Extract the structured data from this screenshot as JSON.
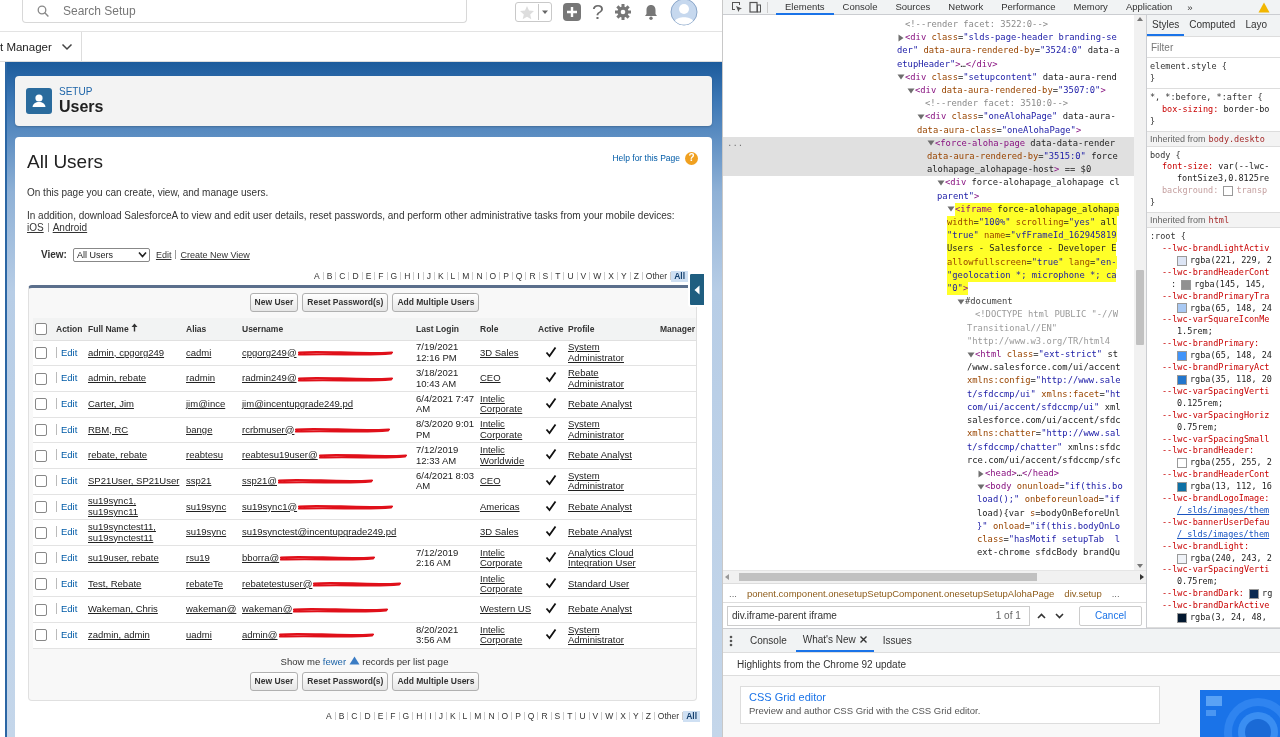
{
  "search": {
    "placeholder": "Search Setup"
  },
  "topbar": {
    "help": "?"
  },
  "nav": {
    "label": "t Manager"
  },
  "header": {
    "eyebrow": "SETUP",
    "title": "Users"
  },
  "page": {
    "title": "All Users",
    "help_link": "Help for this Page",
    "help_icon": "?",
    "intro": "On this page you can create, view, and manage users.",
    "mobile_text": "In addition, download SalesforceA to view and edit user details, reset passwords, and perform other administrative tasks from your mobile devices:",
    "mobile_links": [
      "iOS",
      "Android"
    ]
  },
  "view": {
    "label": "View:",
    "value": "All Users",
    "links": [
      "Edit",
      "Create New View"
    ]
  },
  "alphabet_top": [
    {
      "letter": "A",
      "selected": false
    },
    {
      "letter": "B",
      "selected": false
    },
    {
      "letter": "C",
      "selected": false
    },
    {
      "letter": "D",
      "selected": false
    },
    {
      "letter": "E",
      "selected": false
    },
    {
      "letter": "F",
      "selected": false
    },
    {
      "letter": "G",
      "selected": false
    },
    {
      "letter": "H",
      "selected": false
    },
    {
      "letter": "I",
      "selected": false
    },
    {
      "letter": "J",
      "selected": false
    },
    {
      "letter": "K",
      "selected": false
    },
    {
      "letter": "L",
      "selected": false
    },
    {
      "letter": "M",
      "selected": false
    },
    {
      "letter": "N",
      "selected": false
    },
    {
      "letter": "O",
      "selected": false
    },
    {
      "letter": "P",
      "selected": false
    },
    {
      "letter": "Q",
      "selected": false
    },
    {
      "letter": "R",
      "selected": false
    },
    {
      "letter": "S",
      "selected": false
    },
    {
      "letter": "T",
      "selected": false
    },
    {
      "letter": "U",
      "selected": false
    },
    {
      "letter": "V",
      "selected": false
    },
    {
      "letter": "W",
      "selected": false
    },
    {
      "letter": "X",
      "selected": false
    },
    {
      "letter": "Y",
      "selected": false
    },
    {
      "letter": "Z",
      "selected": false
    },
    {
      "letter": "Other",
      "selected": false
    },
    {
      "letter": "All",
      "selected": true
    }
  ],
  "buttons_top": [
    "New User",
    "Reset Password(s)",
    "Add Multiple Users"
  ],
  "table": {
    "select_all": {
      "checked": false
    },
    "columns": [
      {
        "label": "Action"
      },
      {
        "label": "Full Name",
        "sorted_ascending": true
      },
      {
        "label": "Alias"
      },
      {
        "label": "Username"
      },
      {
        "label": "Last Login"
      },
      {
        "label": "Role"
      },
      {
        "label": "Active"
      },
      {
        "label": "Profile"
      },
      {
        "label": "Manager"
      }
    ],
    "rows": [
      {
        "checked": false,
        "action": "Edit",
        "full_name": "admin, cpgorg249",
        "alias": "cadmi",
        "username": "cpgorg249@",
        "redacted": true,
        "last_login": "7/19/2021 12:16 PM",
        "role": "3D Sales",
        "active": true,
        "profile": "System Administrator"
      },
      {
        "checked": false,
        "action": "Edit",
        "full_name": "admin, rebate",
        "alias": "radmin",
        "username": "radmin249@",
        "redacted": true,
        "last_login": "3/18/2021 10:43 AM",
        "role": "CEO",
        "active": true,
        "profile": "Rebate Administrator"
      },
      {
        "checked": false,
        "action": "Edit",
        "full_name": "Carter, Jim",
        "alias": "jim@ince",
        "username": "jim@incentupgrade249.pd",
        "last_login": "6/4/2021 7:47 AM",
        "role": "Intelic Corporate",
        "active": true,
        "profile": "Rebate Analyst"
      },
      {
        "checked": false,
        "action": "Edit",
        "full_name": "RBM, RC",
        "alias": "bange",
        "username": "rcrbmuser@",
        "redacted": true,
        "last_login": "8/3/2020 9:01 PM",
        "role": "Intelic Corporate",
        "active": true,
        "profile": "System Administrator"
      },
      {
        "checked": false,
        "action": "Edit",
        "full_name": "rebate, rebate",
        "alias": "reabtesu",
        "username": "reabtesu19user@",
        "redacted": true,
        "last_login": "7/12/2019 12:33 AM",
        "role": "Intelic Worldwide",
        "active": true,
        "profile": "Rebate Analyst"
      },
      {
        "checked": false,
        "action": "Edit",
        "full_name": "SP21User, SP21User",
        "alias": "ssp21",
        "username": "ssp21@",
        "redacted": true,
        "last_login": "6/4/2021 8:03 AM",
        "role": "CEO",
        "active": true,
        "profile": "System Administrator"
      },
      {
        "checked": false,
        "action": "Edit",
        "full_name": "su19sync1, su19sync11",
        "alias": "su19sync",
        "username": "su19sync1@",
        "redacted": true,
        "role": "Americas",
        "active": true,
        "profile": "Rebate Analyst"
      },
      {
        "checked": false,
        "action": "Edit",
        "full_name": "su19synctest11, su19synctest11",
        "alias": "su19sync",
        "username": "su19synctest@incentupgrade249.pd",
        "role": "3D Sales",
        "active": true,
        "profile": "Rebate Analyst"
      },
      {
        "checked": false,
        "action": "Edit",
        "full_name": "su19user, rebate",
        "alias": "rsu19",
        "username": "bborra@",
        "redacted": true,
        "last_login": "7/12/2019 2:16 AM",
        "role": "Intelic Corporate",
        "active": true,
        "profile": "Analytics Cloud Integration User"
      },
      {
        "checked": false,
        "action": "Edit",
        "full_name": "Test, Rebate",
        "alias": "rebateTe",
        "username": "rebatetestuser@",
        "redacted": true,
        "role": "Intelic Corporate",
        "active": true,
        "profile": "Standard User"
      },
      {
        "checked": false,
        "action": "Edit",
        "full_name": "Wakeman, Chris",
        "alias": "wakeman@",
        "username": "wakeman@",
        "redacted": true,
        "role": "Western US",
        "active": true,
        "profile": "Rebate Analyst"
      },
      {
        "checked": false,
        "action": "Edit",
        "full_name": "zadmin, admin",
        "alias": "uadmi",
        "username": "admin@",
        "redacted": true,
        "last_login": "8/20/2021 3:56 AM",
        "role": "Intelic Corporate",
        "active": true,
        "profile": "System Administrator"
      }
    ]
  },
  "pager": {
    "before": "Show me",
    "link": "fewer",
    "after": "records per list page"
  },
  "buttons_bottom": [
    "New User",
    "Reset Password(s)",
    "Add Multiple Users"
  ],
  "alphabet_bottom": [
    {
      "letter": "A",
      "selected": false
    },
    {
      "letter": "B",
      "selected": false
    },
    {
      "letter": "C",
      "selected": false
    },
    {
      "letter": "D",
      "selected": false
    },
    {
      "letter": "E",
      "selected": false
    },
    {
      "letter": "F",
      "selected": false
    },
    {
      "letter": "G",
      "selected": false
    },
    {
      "letter": "H",
      "selected": false
    },
    {
      "letter": "I",
      "selected": false
    },
    {
      "letter": "J",
      "selected": false
    },
    {
      "letter": "K",
      "selected": false
    },
    {
      "letter": "L",
      "selected": false
    },
    {
      "letter": "M",
      "selected": false
    },
    {
      "letter": "N",
      "selected": false
    },
    {
      "letter": "O",
      "selected": false
    },
    {
      "letter": "P",
      "selected": false
    },
    {
      "letter": "Q",
      "selected": false
    },
    {
      "letter": "R",
      "selected": false
    },
    {
      "letter": "S",
      "selected": false
    },
    {
      "letter": "T",
      "selected": false
    },
    {
      "letter": "U",
      "selected": false
    },
    {
      "letter": "V",
      "selected": false
    },
    {
      "letter": "W",
      "selected": false
    },
    {
      "letter": "X",
      "selected": false
    },
    {
      "letter": "Y",
      "selected": false
    },
    {
      "letter": "Z",
      "selected": false
    },
    {
      "letter": "Other",
      "selected": false
    },
    {
      "letter": "All",
      "selected": true
    }
  ],
  "devtools": {
    "tabs": [
      {
        "label": "Elements",
        "selected": true
      },
      {
        "label": "Console",
        "selected": false
      },
      {
        "label": "Sources",
        "selected": false
      },
      {
        "label": "Network",
        "selected": false
      },
      {
        "label": "Performance",
        "selected": false
      },
      {
        "label": "Memory",
        "selected": false
      },
      {
        "label": "Application",
        "selected": false
      }
    ],
    "overflow": "»",
    "dom": [
      {
        "kind": "comment",
        "lines": [
          "<!--render facet: 3522:0-->"
        ],
        "selected": false,
        "match": false
      },
      {
        "kind": "element",
        "lines": [
          "<div class=\"slds-page-header branding-se",
          "der\" data-aura-rendered-by=\"3524:0\" data-a",
          "etupHeader\">…</div>"
        ],
        "expanded": false,
        "selected": false,
        "match": false
      },
      {
        "kind": "element",
        "lines": [
          "<div class=\"setupcontent\" data-aura-rend"
        ],
        "expanded": true,
        "selected": false,
        "match": false,
        "children": [
          {
            "kind": "element",
            "lines": [
              "<div data-aura-rendered-by=\"3507:0\">"
            ],
            "expanded": true,
            "selected": false,
            "match": false,
            "children": [
              {
                "kind": "comment",
                "lines": [
                  "<!--render facet: 3510:0-->"
                ],
                "selected": false,
                "match": false
              },
              {
                "kind": "element",
                "lines": [
                  "<div class=\"oneAlohaPage\" data-aura-",
                  "data-aura-class=\"oneAlohaPage\">"
                ],
                "expanded": true,
                "selected": false,
                "match": false,
                "children": [
                  {
                    "kind": "element",
                    "lines": [
                      "<force-aloha-page data-data-render",
                      "data-aura-rendered-by=\"3515:0\" force",
                      "alohapage_alohapage-host> == $0"
                    ],
                    "expanded": true,
                    "selected": true,
                    "match": false,
                    "gutter": "...",
                    "children": [
                      {
                        "kind": "element",
                        "lines": [
                          "<div force-alohapage_alohapage cl",
                          "parent\">"
                        ],
                        "expanded": true,
                        "selected": false,
                        "match": false,
                        "children": [
                          {
                            "kind": "element",
                            "lines": [
                              "<iframe force-alohapage_alohapa",
                              "width=\"100%\" scrolling=\"yes\" all",
                              "\"true\" name=\"vfFrameId_162945819",
                              "Users - Salesforce - Developer E",
                              "allowfullscreen=\"true\" lang=\"en-",
                              "\"geolocation *; microphone *; ca",
                              "\"0\">"
                            ],
                            "expanded": true,
                            "selected": false,
                            "match": true,
                            "children": [
                              {
                                "kind": "document",
                                "lines": [
                                  "#document"
                                ],
                                "expanded": true,
                                "selected": false,
                                "match": false,
                                "children": [
                                  {
                                    "kind": "doctype",
                                    "lines": [
                                      "<!DOCTYPE html PUBLIC \"-//W",
                                      "Transitional//EN\"",
                                      "\"http://www.w3.org/TR/html4"
                                    ],
                                    "selected": false,
                                    "match": false
                                  },
                                  {
                                    "kind": "element",
                                    "lines": [
                                      "<html class=\"ext-strict\" st",
                                      "/www.salesforce.com/ui/accent",
                                      "xmlns:config=\"http://www.sale",
                                      "t/sfdccmp/ui\" xmlns:facet=\"ht",
                                      "com/ui/accent/sfdccmp/ui\" xml",
                                      "salesforce.com/ui/accent/sfdc",
                                      "xmlns:chatter=\"http://www.sal",
                                      "t/sfdccmp/chatter\" xmlns:sfdc",
                                      "rce.com/ui/accent/sfdccmp/sfc"
                                    ],
                                    "expanded": true,
                                    "selected": false,
                                    "match": false,
                                    "children": [
                                      {
                                        "kind": "element",
                                        "lines": [
                                          "<head>…</head>"
                                        ],
                                        "expanded": false,
                                        "selected": false,
                                        "match": false
                                      },
                                      {
                                        "kind": "element",
                                        "lines": [
                                          "<body onunload=\"if(this.bo",
                                          "load();\" onbeforeunload=\"if",
                                          "load){var s=bodyOnBeforeUnl",
                                          "}\" onload=\"if(this.bodyOnLo",
                                          "class=\"hasMotif setupTab  l",
                                          "ext-chrome sfdcBody brandQu"
                                        ],
                                        "expanded": true,
                                        "selected": false,
                                        "match": false
                                      }
                                    ]
                                  }
                                ]
                              }
                            ]
                          }
                        ]
                      }
                    ]
                  }
                ]
              }
            ]
          }
        ]
      }
    ],
    "breadcrumb": [
      {
        "kind": "ellipsis",
        "text": "..."
      },
      {
        "kind": "crumb",
        "text": "ponent.component.onesetupSetupComponent.onesetupSetupAlohaPage"
      },
      {
        "kind": "crumb",
        "text": "div.setup"
      },
      {
        "kind": "ellipsis",
        "text": "..."
      }
    ],
    "find": {
      "value": "div.iframe-parent iframe",
      "count": "1 of 1",
      "cancel": "Cancel"
    },
    "styles": {
      "tabs": [
        {
          "label": "Styles",
          "selected": true
        },
        {
          "label": "Computed",
          "selected": false
        },
        {
          "label": "Layo",
          "selected": false
        }
      ],
      "filter": {
        "placeholder": "Filter"
      },
      "sections": [
        {
          "kind": "rule",
          "lines": [
            {
              "kind": "selector",
              "text": "element.style {"
            },
            {
              "kind": "brace",
              "text": "}"
            }
          ]
        },
        {
          "kind": "rule",
          "lines": [
            {
              "kind": "selector",
              "text": "*, *:before, *:after {"
            },
            {
              "kind": "decl",
              "name": "box-sizing:",
              "value": "border-bo",
              "inactive": false
            },
            {
              "kind": "brace",
              "text": "}"
            }
          ]
        },
        {
          "kind": "inherited",
          "label": "Inherited from",
          "source": "body.deskto"
        },
        {
          "kind": "rule",
          "lines": [
            {
              "kind": "selector",
              "text": "body {"
            },
            {
              "kind": "decl",
              "name": "font-size:",
              "value": "var(--lwc-",
              "inactive": false
            },
            {
              "kind": "value",
              "text": "fontSize3,0.8125re"
            },
            {
              "kind": "decl",
              "name": "background:",
              "value": "transp",
              "inactive": true,
              "color": "#ffffff"
            },
            {
              "kind": "brace",
              "text": "}"
            }
          ]
        },
        {
          "kind": "inherited",
          "label": "Inherited from",
          "source": "html"
        },
        {
          "kind": "rule",
          "lines": [
            {
              "kind": "selector",
              "text": ":root {"
            },
            {
              "kind": "decl",
              "name": "--lwc-brandLightActiv",
              "inactive": false
            },
            {
              "kind": "value",
              "color": "#dde5f5",
              "text": "rgba(221, 229, 2"
            },
            {
              "kind": "decl",
              "name": "--lwc-brandHeaderCont",
              "inactive": false
            },
            {
              "kind": "value",
              "lead": ":",
              "color": "#919191",
              "text": "rgba(145, 145,"
            },
            {
              "kind": "decl",
              "name": "--lwc-brandPrimaryTra",
              "inactive": false
            },
            {
              "kind": "value",
              "color": "#a9c9f3",
              "text": "rgba(65, 148, 24"
            },
            {
              "kind": "decl",
              "name": "--lwc-varSquareIconMe",
              "inactive": false
            },
            {
              "kind": "value",
              "text": "1.5rem;"
            },
            {
              "kind": "decl",
              "name": "--lwc-brandPrimary:",
              "inactive": false
            },
            {
              "kind": "value",
              "color": "#4194f9",
              "text": "rgba(65, 148, 24"
            },
            {
              "kind": "decl",
              "name": "--lwc-brandPrimaryAct",
              "inactive": false
            },
            {
              "kind": "value",
              "color": "#2376cc",
              "text": "rgba(35, 118, 20"
            },
            {
              "kind": "decl",
              "name": "--lwc-varSpacingVerti",
              "inactive": false
            },
            {
              "kind": "value",
              "text": "0.125rem;"
            },
            {
              "kind": "decl",
              "name": "--lwc-varSpacingHoriz",
              "inactive": false
            },
            {
              "kind": "value",
              "text": "0.75rem;"
            },
            {
              "kind": "decl",
              "name": "--lwc-varSpacingSmall",
              "inactive": false
            },
            {
              "kind": "decl",
              "name": "--lwc-brandHeader:",
              "inactive": false
            },
            {
              "kind": "value",
              "color": "#ffffff",
              "text": "rgba(255, 255, 2"
            },
            {
              "kind": "decl",
              "name": "--lwc-brandHeaderCont",
              "inactive": false
            },
            {
              "kind": "value",
              "color": "#0d70a5",
              "text": "rgba(13, 112, 16"
            },
            {
              "kind": "decl",
              "name": "--lwc-brandLogoImage:",
              "inactive": false
            },
            {
              "kind": "link",
              "text": "/_slds/images/them"
            },
            {
              "kind": "decl",
              "name": "--lwc-bannerUserDefau",
              "inactive": false
            },
            {
              "kind": "link",
              "text": "/_slds/images/them"
            },
            {
              "kind": "decl",
              "name": "--lwc-brandLight:",
              "inactive": false
            },
            {
              "kind": "value",
              "color": "#f0f3f8",
              "text": "rgba(240, 243, 2"
            },
            {
              "kind": "decl",
              "name": "--lwc-varSpacingVerti",
              "inactive": false
            },
            {
              "kind": "value",
              "text": "0.75rem;"
            },
            {
              "kind": "decl",
              "name": "--lwc-brandDark:",
              "color": "#0b2a52",
              "value": "rg",
              "inactive": false
            },
            {
              "kind": "decl",
              "name": "--lwc-brandDarkActive",
              "inactive": false
            },
            {
              "kind": "value",
              "color": "#031830",
              "text": "rgba(3, 24, 48,"
            }
          ]
        }
      ]
    },
    "drawer": {
      "tabs": [
        {
          "label": "Console",
          "selected": false,
          "closable": false
        },
        {
          "label": "What's New",
          "selected": true,
          "closable": true
        },
        {
          "label": "Issues",
          "selected": false,
          "closable": false
        }
      ],
      "heading": "Highlights from the Chrome 92 update",
      "cards": [
        {
          "title": "CSS Grid editor",
          "text": "Preview and author CSS Grid with the CSS Grid editor."
        }
      ]
    }
  }
}
